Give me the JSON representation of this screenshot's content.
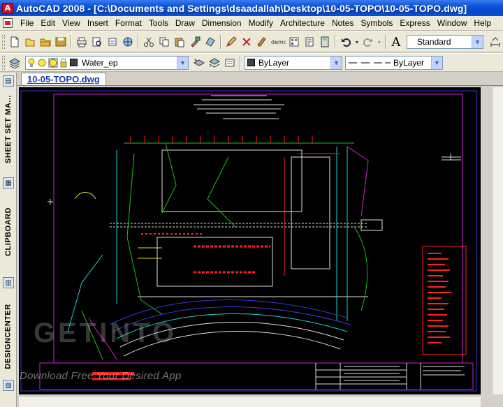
{
  "window": {
    "title": "AutoCAD 2008 - [C:\\Documents and Settings\\dsaadallah\\Desktop\\10-05-TOPO\\10-05-TOPO.dwg]",
    "app_icon_letter": "A"
  },
  "menu": [
    "File",
    "Edit",
    "View",
    "Insert",
    "Format",
    "Tools",
    "Draw",
    "Dimension",
    "Modify",
    "Architecture",
    "Notes",
    "Symbols",
    "Express",
    "Window",
    "Help"
  ],
  "toolbar1": {
    "text_style_icon": "A",
    "text_style": "Standard"
  },
  "toolbar2": {
    "layer": "Water_ep",
    "color": "ByLayer",
    "linetype": "ByLayer",
    "layer_swatch_color": "#404040",
    "color_swatch_color": "#404040"
  },
  "palettes": [
    "SHEET SET MA...",
    "CLIPBOARD",
    "DESIGNCENTER"
  ],
  "document_tab": "10-05-TOPO.dwg",
  "watermark": {
    "logo": "GETINTO",
    "tagline": "Download Free Your Desired App"
  },
  "colors": {
    "titlebar": "#0a53d8",
    "canvas_bg": "#000000",
    "border_blue": "#3a3ad8",
    "magenta": "#d020d0",
    "red": "#ff2020",
    "white": "#ffffff",
    "green": "#20c020",
    "cyan": "#20d0d0",
    "yellow": "#e0e020"
  }
}
